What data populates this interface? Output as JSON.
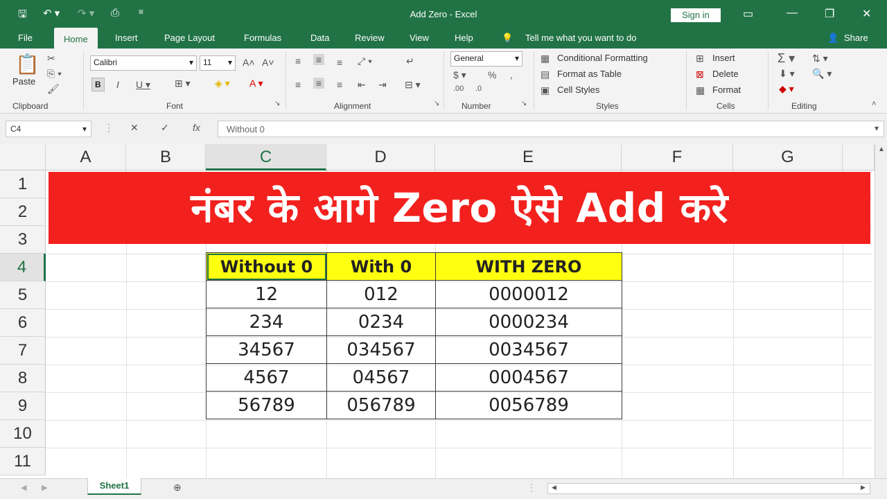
{
  "window": {
    "title": "Add Zero  -  Excel",
    "sign_in": "Sign in"
  },
  "tabs": [
    "File",
    "Home",
    "Insert",
    "Page Layout",
    "Formulas",
    "Data",
    "Review",
    "View",
    "Help"
  ],
  "tell_me": "Tell me what you want to do",
  "share": "Share",
  "ribbon": {
    "clipboard": {
      "label": "Clipboard",
      "paste": "Paste"
    },
    "font": {
      "label": "Font",
      "name": "Calibri",
      "size": "11"
    },
    "alignment": {
      "label": "Alignment"
    },
    "number": {
      "label": "Number",
      "format": "General"
    },
    "styles": {
      "label": "Styles",
      "conditional": "Conditional Formatting",
      "format_table": "Format as Table",
      "cell_styles": "Cell Styles"
    },
    "cells": {
      "label": "Cells",
      "insert": "Insert",
      "delete": "Delete",
      "format": "Format"
    },
    "editing": {
      "label": "Editing"
    }
  },
  "formula_bar": {
    "name_box": "C4",
    "formula": "Without 0"
  },
  "columns": [
    "A",
    "B",
    "C",
    "D",
    "E",
    "F",
    "G"
  ],
  "rows": [
    "1",
    "2",
    "3",
    "4",
    "5",
    "6",
    "7",
    "8",
    "9",
    "10",
    "11"
  ],
  "selected_cell": {
    "column": "C",
    "row": "4"
  },
  "banner": "नंबर के आगे Zero ऐसे Add करे",
  "table": {
    "headers": [
      "Without 0",
      "With 0",
      "WITH ZERO"
    ],
    "rows": [
      [
        "12",
        "012",
        "0000012"
      ],
      [
        "234",
        "0234",
        "0000234"
      ],
      [
        "34567",
        "034567",
        "0034567"
      ],
      [
        "4567",
        "04567",
        "0004567"
      ],
      [
        "56789",
        "056789",
        "0056789"
      ]
    ]
  },
  "sheet_tab": "Sheet1",
  "colors": {
    "excel_green": "#217346",
    "banner_red": "#f2211e",
    "header_yellow": "#ffff10"
  }
}
